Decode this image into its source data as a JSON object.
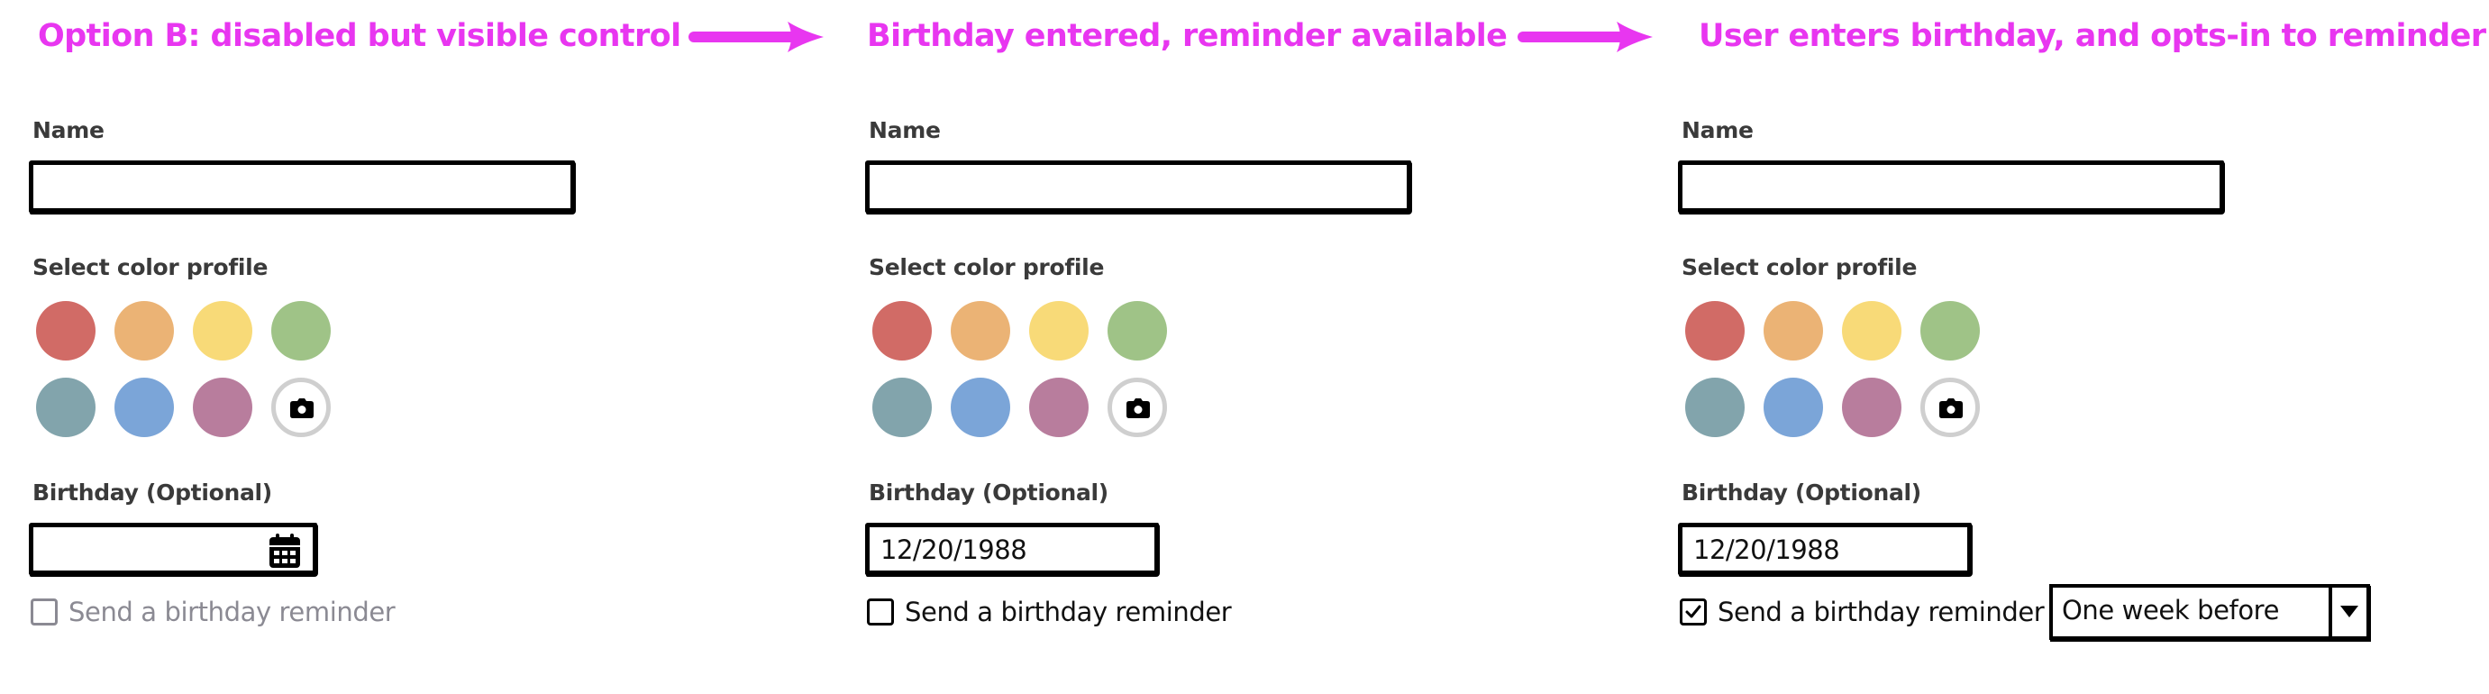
{
  "steps": [
    {
      "title": "Option B: disabled but visible control"
    },
    {
      "title": "Birthday entered, reminder available"
    },
    {
      "title": "User enters birthday, and opts-in to reminder"
    }
  ],
  "arrow_color": "#E836F0",
  "form": {
    "name_label": "Name",
    "color_label": "Select color profile",
    "birthday_label": "Birthday (Optional)",
    "reminder_label": "Send a birthday reminder",
    "colors": [
      {
        "name": "red",
        "hex": "#D16B66"
      },
      {
        "name": "orange",
        "hex": "#EBB375"
      },
      {
        "name": "yellow",
        "hex": "#F8DA78"
      },
      {
        "name": "green",
        "hex": "#9FC387"
      },
      {
        "name": "teal",
        "hex": "#82A4AC"
      },
      {
        "name": "blue",
        "hex": "#7BA5D8"
      },
      {
        "name": "mauve",
        "hex": "#B87D9D"
      }
    ],
    "camera_icon": "camera-icon",
    "calendar_icon": "calendar-icon"
  },
  "panels": [
    {
      "name_value": "",
      "birthday_value": "",
      "reminder_checked": false,
      "reminder_disabled": true,
      "show_calendar_icon": true,
      "show_dropdown": false
    },
    {
      "name_value": "",
      "birthday_value": "12/20/1988",
      "reminder_checked": false,
      "reminder_disabled": false,
      "show_calendar_icon": false,
      "show_dropdown": false
    },
    {
      "name_value": "",
      "birthday_value": "12/20/1988",
      "reminder_checked": true,
      "reminder_disabled": false,
      "show_calendar_icon": false,
      "show_dropdown": true,
      "dropdown_value": "One week before"
    }
  ]
}
